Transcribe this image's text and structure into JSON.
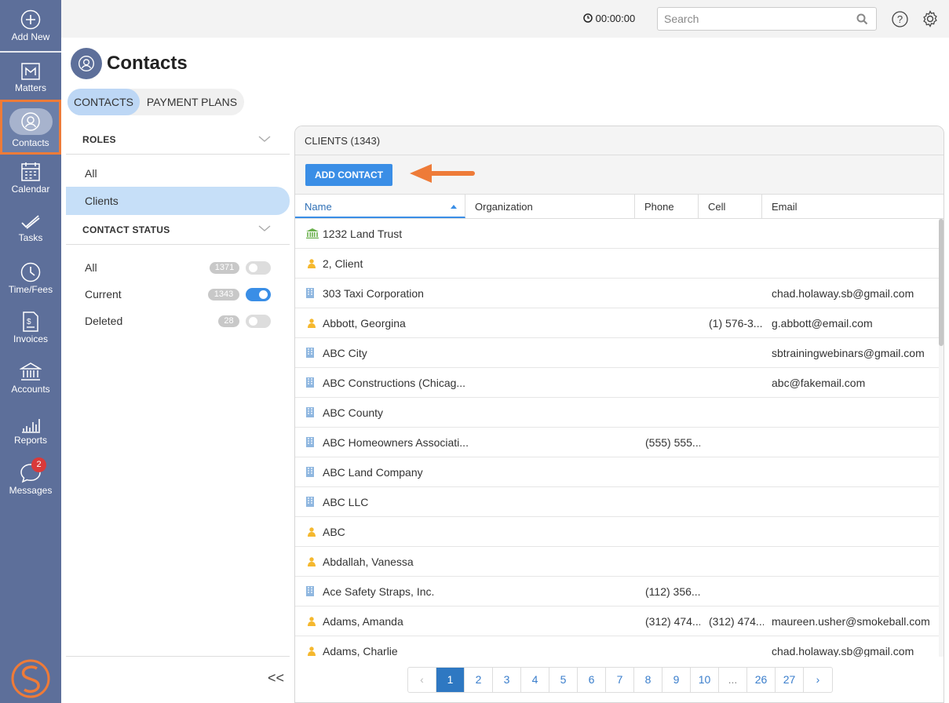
{
  "nav": {
    "add_new": "Add New",
    "matters": "Matters",
    "contacts": "Contacts",
    "calendar": "Calendar",
    "tasks": "Tasks",
    "time_fees": "Time/Fees",
    "invoices": "Invoices",
    "accounts": "Accounts",
    "reports": "Reports",
    "messages": "Messages",
    "messages_badge": "2"
  },
  "topbar": {
    "timer": "00:00:00",
    "search_placeholder": "Search"
  },
  "page": {
    "title": "Contacts",
    "tabs": [
      "CONTACTS",
      "PAYMENT PLANS"
    ],
    "active_tab": "CONTACTS"
  },
  "filters": {
    "roles_header": "ROLES",
    "roles": [
      "All",
      "Clients"
    ],
    "selected_role": "Clients",
    "status_header": "CONTACT STATUS",
    "statuses": [
      {
        "label": "All",
        "count": "1371",
        "on": false
      },
      {
        "label": "Current",
        "count": "1343",
        "on": true
      },
      {
        "label": "Deleted",
        "count": "28",
        "on": false
      }
    ],
    "collapse": "<<"
  },
  "list": {
    "header": "CLIENTS (1343)",
    "add_button": "ADD CONTACT",
    "columns": [
      "Name",
      "Organization",
      "Phone",
      "Cell",
      "Email"
    ],
    "rows": [
      {
        "type": "trust",
        "name": "1232 Land Trust",
        "organization": "",
        "phone": "",
        "cell": "",
        "email": ""
      },
      {
        "type": "person",
        "name": "2, Client",
        "organization": "",
        "phone": "",
        "cell": "",
        "email": ""
      },
      {
        "type": "company",
        "name": "303 Taxi Corporation",
        "organization": "",
        "phone": "",
        "cell": "",
        "email": "chad.holaway.sb@gmail.com"
      },
      {
        "type": "person",
        "name": "Abbott, Georgina",
        "organization": "",
        "phone": "",
        "cell": "(1) 576-3...",
        "email": "g.abbott@email.com"
      },
      {
        "type": "company",
        "name": "ABC City",
        "organization": "",
        "phone": "",
        "cell": "",
        "email": "sbtrainingwebinars@gmail.com"
      },
      {
        "type": "company",
        "name": "ABC Constructions (Chicag...",
        "organization": "",
        "phone": "",
        "cell": "",
        "email": "abc@fakemail.com"
      },
      {
        "type": "company",
        "name": "ABC County",
        "organization": "",
        "phone": "",
        "cell": "",
        "email": ""
      },
      {
        "type": "company",
        "name": "ABC Homeowners Associati...",
        "organization": "",
        "phone": "(555) 555...",
        "cell": "",
        "email": ""
      },
      {
        "type": "company",
        "name": "ABC Land Company",
        "organization": "",
        "phone": "",
        "cell": "",
        "email": ""
      },
      {
        "type": "company",
        "name": "ABC LLC",
        "organization": "",
        "phone": "",
        "cell": "",
        "email": ""
      },
      {
        "type": "person",
        "name": "ABC",
        "organization": "",
        "phone": "",
        "cell": "",
        "email": ""
      },
      {
        "type": "person",
        "name": "Abdallah, Vanessa",
        "organization": "",
        "phone": "",
        "cell": "",
        "email": ""
      },
      {
        "type": "company",
        "name": "Ace Safety Straps, Inc.",
        "organization": "",
        "phone": "(112) 356...",
        "cell": "",
        "email": ""
      },
      {
        "type": "person",
        "name": "Adams, Amanda",
        "organization": "",
        "phone": "(312) 474...",
        "cell": "(312) 474...",
        "email": "maureen.usher@smokeball.com"
      },
      {
        "type": "person",
        "name": "Adams, Charlie",
        "organization": "",
        "phone": "",
        "cell": "",
        "email": "chad.holaway.sb@gmail.com"
      }
    ]
  },
  "pagination": {
    "prev": "‹",
    "next": "›",
    "pages": [
      "1",
      "2",
      "3",
      "4",
      "5",
      "6",
      "7",
      "8",
      "9",
      "10",
      "...",
      "26",
      "27"
    ],
    "current": "1"
  },
  "colors": {
    "sidebar": "#5d6f9a",
    "accent": "#3a8ee6",
    "highlight": "#ee7b38",
    "person_icon": "#f5b82e",
    "company_icon": "#8fb7e0",
    "trust_icon": "#6ab04c"
  }
}
